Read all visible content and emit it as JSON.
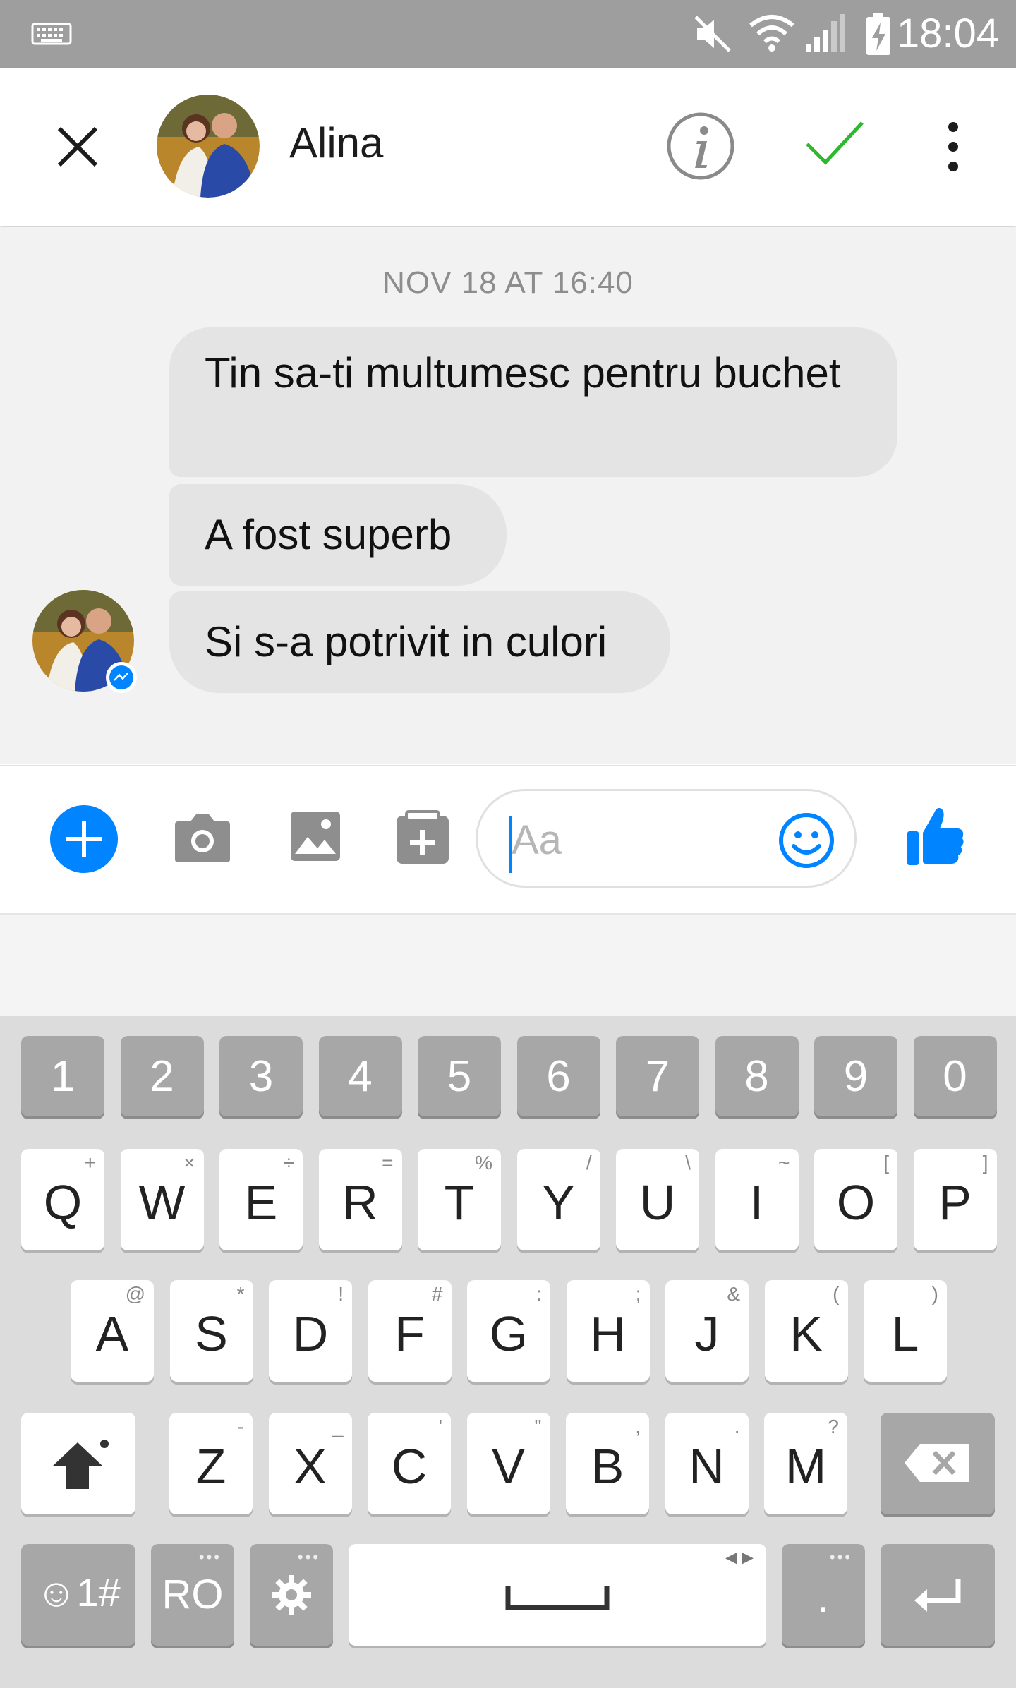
{
  "status_bar": {
    "time": "18:04",
    "icons": [
      "keyboard-icon",
      "mute-icon",
      "wifi-icon",
      "signal-icon",
      "battery-charging-icon"
    ]
  },
  "header": {
    "contact_name": "Alina",
    "icons": [
      "close-icon",
      "info-icon",
      "check-icon",
      "more-vert-icon"
    ],
    "accent": "#0084ff",
    "check_color": "#2db82d"
  },
  "conversation": {
    "date_separator": "NOV 18 AT 16:40",
    "messages": [
      {
        "text": "Tin sa-ti multumesc pentru buchet"
      },
      {
        "text": "A fost superb"
      },
      {
        "text": "Si s-a potrivit in culori"
      }
    ],
    "bubble_color": "#e4e4e4"
  },
  "composer": {
    "placeholder": "Aa",
    "icons": [
      "plus-icon",
      "camera-icon",
      "gallery-icon",
      "sticker-icon",
      "emoji-icon",
      "thumbs-up-icon"
    ]
  },
  "keyboard": {
    "numbers": [
      "1",
      "2",
      "3",
      "4",
      "5",
      "6",
      "7",
      "8",
      "9",
      "0"
    ],
    "row1": [
      {
        "k": "Q",
        "h": "+"
      },
      {
        "k": "W",
        "h": "×"
      },
      {
        "k": "E",
        "h": "÷"
      },
      {
        "k": "R",
        "h": "="
      },
      {
        "k": "T",
        "h": "%"
      },
      {
        "k": "Y",
        "h": "/"
      },
      {
        "k": "U",
        "h": "\\"
      },
      {
        "k": "I",
        "h": "~"
      },
      {
        "k": "O",
        "h": "["
      },
      {
        "k": "P",
        "h": "]"
      }
    ],
    "row2": [
      {
        "k": "A",
        "h": "@"
      },
      {
        "k": "S",
        "h": "*"
      },
      {
        "k": "D",
        "h": "!"
      },
      {
        "k": "F",
        "h": "#"
      },
      {
        "k": "G",
        "h": ":"
      },
      {
        "k": "H",
        "h": ";"
      },
      {
        "k": "J",
        "h": "&"
      },
      {
        "k": "K",
        "h": "("
      },
      {
        "k": "L",
        "h": ")"
      }
    ],
    "row3": [
      {
        "k": "Z",
        "h": "-"
      },
      {
        "k": "X",
        "h": "_"
      },
      {
        "k": "C",
        "h": "'"
      },
      {
        "k": "V",
        "h": "\""
      },
      {
        "k": "B",
        "h": ","
      },
      {
        "k": "N",
        "h": "."
      },
      {
        "k": "M",
        "h": "?"
      }
    ],
    "symbols_label": "☺1#",
    "language_label": "RO",
    "period_label": "."
  }
}
